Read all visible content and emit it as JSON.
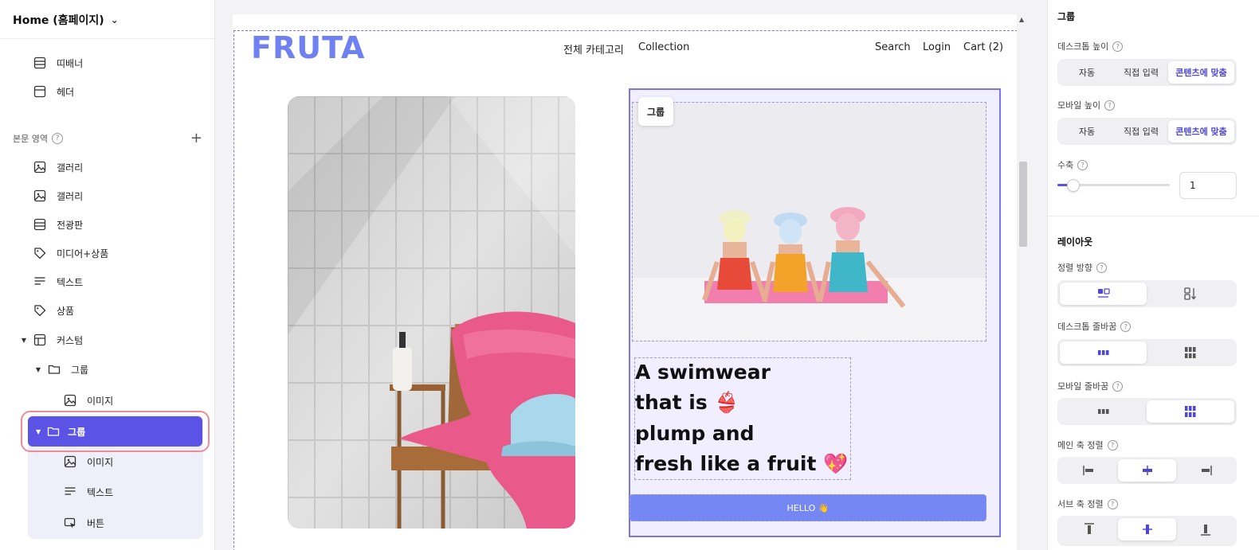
{
  "sidebar": {
    "page_select": "Home (홈페이지)",
    "top_items": [
      {
        "label": "띠배너",
        "icon": "banner-icon"
      },
      {
        "label": "헤더",
        "icon": "header-icon"
      }
    ],
    "body_section": {
      "label": "본문 영역"
    },
    "items": [
      {
        "label": "갤러리",
        "icon": "image-icon"
      },
      {
        "label": "갤러리",
        "icon": "image-icon"
      },
      {
        "label": "전광판",
        "icon": "banner-icon"
      },
      {
        "label": "미디어+상품",
        "icon": "tag-icon"
      },
      {
        "label": "텍스트",
        "icon": "text-icon"
      },
      {
        "label": "상품",
        "icon": "tag-icon"
      },
      {
        "label": "커스텀",
        "icon": "layout-icon"
      },
      {
        "label": "그룹",
        "icon": "folder-icon"
      },
      {
        "label": "이미지",
        "icon": "image-icon"
      },
      {
        "label": "그룹",
        "icon": "folder-icon"
      },
      {
        "label": "이미지",
        "icon": "image-icon"
      },
      {
        "label": "텍스트",
        "icon": "text-icon"
      },
      {
        "label": "버튼",
        "icon": "cursor-icon"
      }
    ]
  },
  "canvas": {
    "logo": "FRUTA",
    "nav_center": [
      "전체 카테고리",
      "Collection"
    ],
    "nav_right": [
      "Search",
      "Login",
      "Cart (2)"
    ],
    "group_tag": "그룹",
    "headline": [
      "A swimwear",
      "that is 👙",
      "plump and",
      "fresh like a fruit 💖"
    ],
    "button_label": "HELLO 👋"
  },
  "panel": {
    "title": "그룹",
    "desktop_height": {
      "label": "데스크톱 높이",
      "options": [
        "자동",
        "직접 입력",
        "콘텐츠에 맞춤"
      ],
      "selected": 2
    },
    "mobile_height": {
      "label": "모바일 높이",
      "options": [
        "자동",
        "직접 입력",
        "콘텐츠에 맞춤"
      ],
      "selected": 2
    },
    "shrink": {
      "label": "수축",
      "value": "1",
      "slider_fraction": 0.1
    },
    "layout_title": "레이아웃",
    "direction": {
      "label": "정렬 방향",
      "selected": 0
    },
    "desktop_wrap": {
      "label": "데스크톱 줄바꿈",
      "selected": 0
    },
    "mobile_wrap": {
      "label": "모바일 줄바꿈",
      "selected": 1
    },
    "main_axis": {
      "label": "메인 축 정렬",
      "selected": 1
    },
    "cross_axis": {
      "label": "서브 축 정렬",
      "selected": 1
    }
  },
  "colors": {
    "accent": "#5b52e6",
    "logo": "#6f80f0",
    "button": "#7587f2"
  }
}
